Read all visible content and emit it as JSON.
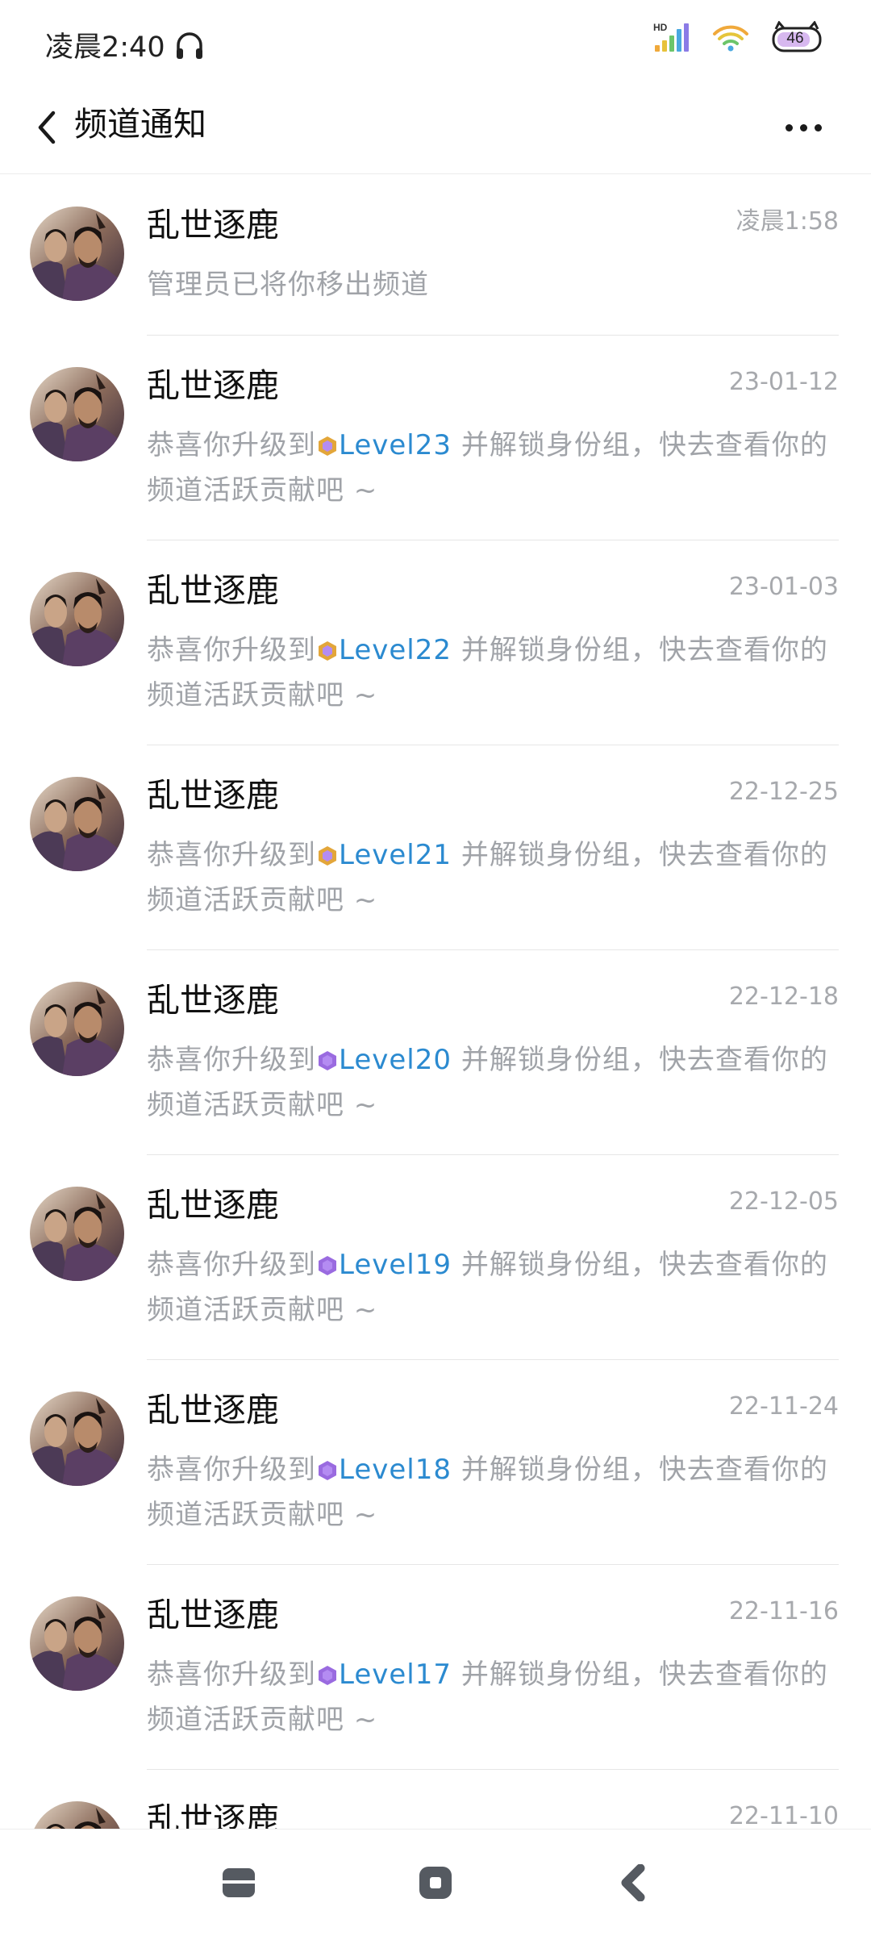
{
  "status_bar": {
    "time": "凌晨2:40",
    "battery": "46",
    "network_label": "HD",
    "icons": [
      "headphones-icon",
      "signal-icon",
      "wifi-icon",
      "battery-icon"
    ]
  },
  "header": {
    "title": "频道通知",
    "back_icon": "chevron-left-icon",
    "more_icon": "more-icon"
  },
  "colors": {
    "level_link": "#2b8ad0",
    "muted_text": "#a0a3a8",
    "divider": "#e6e6e6"
  },
  "notifications": [
    {
      "name": "乱世逐鹿",
      "time": "凌晨1:58",
      "message": "管理员已将你移出频道"
    },
    {
      "name": "乱世逐鹿",
      "time": "23-01-12",
      "msg_prefix": "恭喜你升级到",
      "level": "Level23",
      "msg_suffix": " 并解锁身份组，快去查看你的频道活跃贡献吧 ~"
    },
    {
      "name": "乱世逐鹿",
      "time": "23-01-03",
      "msg_prefix": "恭喜你升级到",
      "level": "Level22",
      "msg_suffix": " 并解锁身份组，快去查看你的频道活跃贡献吧 ~"
    },
    {
      "name": "乱世逐鹿",
      "time": "22-12-25",
      "msg_prefix": "恭喜你升级到",
      "level": "Level21",
      "msg_suffix": " 并解锁身份组，快去查看你的频道活跃贡献吧 ~"
    },
    {
      "name": "乱世逐鹿",
      "time": "22-12-18",
      "msg_prefix": "恭喜你升级到",
      "level": "Level20",
      "msg_suffix": " 并解锁身份组，快去查看你的频道活跃贡献吧 ~"
    },
    {
      "name": "乱世逐鹿",
      "time": "22-12-05",
      "msg_prefix": "恭喜你升级到",
      "level": "Level19",
      "msg_suffix": " 并解锁身份组，快去查看你的频道活跃贡献吧 ~"
    },
    {
      "name": "乱世逐鹿",
      "time": "22-11-24",
      "msg_prefix": "恭喜你升级到",
      "level": "Level18",
      "msg_suffix": " 并解锁身份组，快去查看你的频道活跃贡献吧 ~"
    },
    {
      "name": "乱世逐鹿",
      "time": "22-11-16",
      "msg_prefix": "恭喜你升级到",
      "level": "Level17",
      "msg_suffix": " 并解锁身份组，快去查看你的频道活跃贡献吧 ~"
    },
    {
      "name": "乱世逐鹿",
      "time": "22-11-10"
    }
  ],
  "nav_bar": {
    "icons": [
      "recent-apps-icon",
      "home-icon",
      "back-icon"
    ]
  }
}
